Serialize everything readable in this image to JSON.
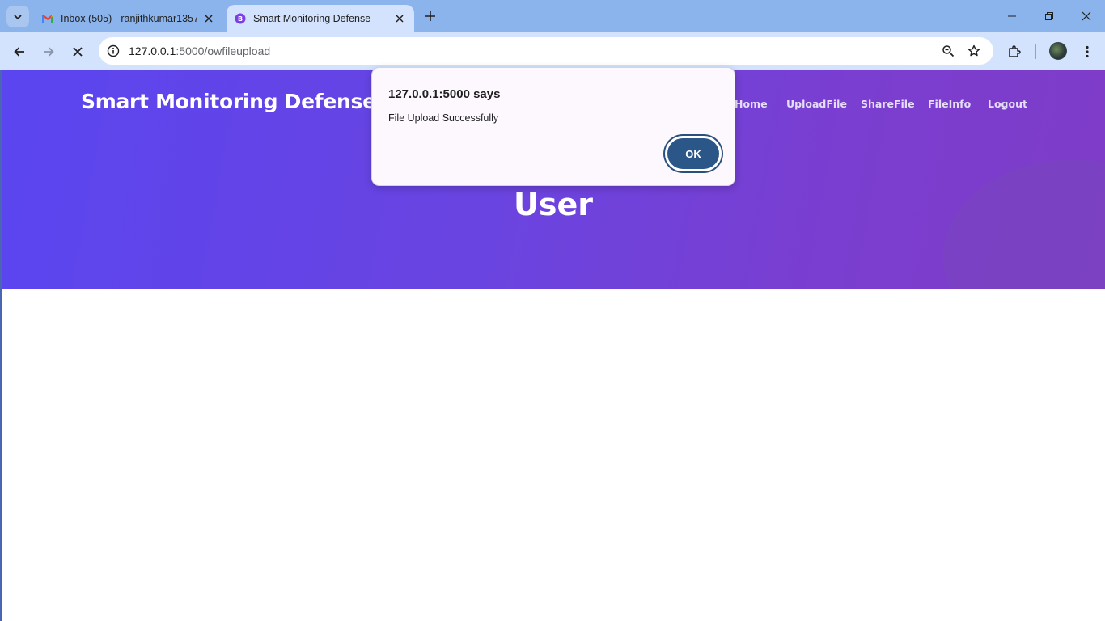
{
  "browser": {
    "tabs": [
      {
        "title": "Inbox (505) - ranjithkumar1357",
        "icon": "gmail-icon",
        "active": false
      },
      {
        "title": "Smart Monitoring Defense",
        "icon": "site-favicon",
        "active": true
      }
    ],
    "url_host": "127.0.0.1",
    "url_path": ":5000/owfileupload"
  },
  "site": {
    "brand": "Smart Monitoring Defense",
    "nav": [
      {
        "label": "Home"
      },
      {
        "label": "UploadFile"
      },
      {
        "label": "ShareFile"
      },
      {
        "label": "FileInfo"
      },
      {
        "label": "Logout"
      }
    ],
    "hero_title": "User"
  },
  "dialog": {
    "title": "127.0.0.1:5000 says",
    "message": "File Upload Successfully",
    "ok_label": "OK"
  },
  "colors": {
    "hero_start": "#5a45f0",
    "hero_end": "#7f3cc8",
    "tabstrip": "#8cb4ec",
    "toolbar": "#d3e3fd",
    "ok_button": "#2b5688"
  }
}
